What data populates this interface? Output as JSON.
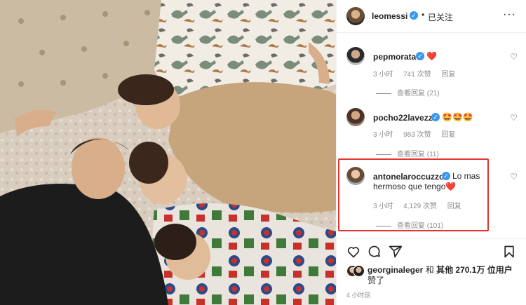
{
  "post": {
    "author": "leomessi",
    "follow_state": "已关注",
    "dot": "•",
    "more": "···"
  },
  "comments": [
    {
      "username": "pepmorata",
      "text": "❤️",
      "time": "3 小时",
      "likes": "741 次赞",
      "reply": "回复",
      "view_replies": "查看回复 (21)"
    },
    {
      "username": "pocho22lavezzi",
      "text": "🤩🤩🤩",
      "time": "3 小时",
      "likes": "983 次赞",
      "reply": "回复",
      "view_replies": "查看回复 (11)"
    },
    {
      "username": "antonelaroccuzzo",
      "text": "Lo mas hermoso que tengo❤️",
      "time": "3 小时",
      "likes": "4,129 次赞",
      "reply": "回复",
      "view_replies": "查看回复 (101)"
    }
  ],
  "likes_line": {
    "user": "georginaleger",
    "connector": "和",
    "others": "其他 270.1万 位用户",
    "suffix": "赞了"
  },
  "time_ago": "4 小时前",
  "colors": {
    "verified": "#3897f0",
    "highlight": "#e3342f",
    "heart": "#ed4956",
    "muted": "#8e8e8e"
  },
  "icons": [
    "heart-icon",
    "comment-icon",
    "share-icon",
    "bookmark-icon",
    "more-icon",
    "verified-badge"
  ]
}
